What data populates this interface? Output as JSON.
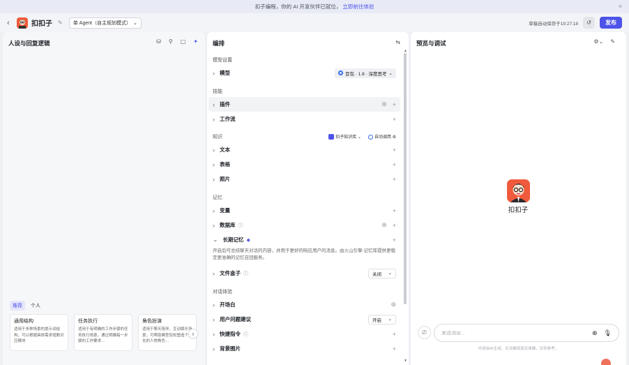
{
  "banner": {
    "text": "扣子编程，你的 AI 开发伙伴已就位，",
    "link": "立即前往体验",
    "close": "×"
  },
  "topbar": {
    "back": "‹",
    "bot_name": "扣扣子",
    "edit": "✎",
    "mode": "单 Agent（自主规划模式）",
    "mode_chevron": "⌄",
    "save_status": "草稿自动保存于19:27:18",
    "history_icon": "↺",
    "publish": "发布"
  },
  "left": {
    "title": "人设与回复逻辑",
    "tools": [
      "⛁",
      "⚲",
      "▢",
      "✦"
    ],
    "tabs": [
      "推荐",
      "个人"
    ],
    "cards": [
      {
        "title": "通用结构",
        "desc": "适用于多种场景的提示词结构，可以根据具体需求增删对应模块"
      },
      {
        "title": "任务执行",
        "desc": "适用于有明确的工作步骤的任务执行场景，通过明确每一步骤的工作要求…"
      },
      {
        "title": "角色扮演",
        "desc": "适用于聊天陪伴、互动娱乐场景，可帮助模型轻松塑造个性化的人物角色…"
      }
    ],
    "next": "›"
  },
  "mid": {
    "title": "编排",
    "icon": "⇆",
    "model_section": "模型设置",
    "model_label": "模型",
    "model_value": "豆包 · 1.8 · 深度思考",
    "skills_section": "技能",
    "plugin": "插件",
    "workflow": "工作流",
    "knowledge_section": "知识",
    "kb_source": "扣子知识库",
    "kb_auto": "自动调用",
    "text": "文本",
    "table": "表格",
    "photo": "照片",
    "memory_section": "记忆",
    "variable": "变量",
    "database": "数据库",
    "longterm": "长期记忆",
    "longterm_desc": "开启后可总结聊天对话的内容，并用于更好的响应用户的消息。由火山引擎-记忆库提供更稳定更准确的记忆召回服务。",
    "filebox": "文件盒子",
    "filebox_value": "关闭",
    "dialog_section": "对话体验",
    "opening": "开场白",
    "suggest": "用户问题建议",
    "suggest_value": "开启",
    "shortcut": "快捷指令",
    "background": "背景图片"
  },
  "right": {
    "title": "预览与调试",
    "tools": [
      "⚙⌄",
      "✎"
    ],
    "bot_name": "扣扣子",
    "input_placeholder": "发送消息...",
    "disclaimer": "内容由AI生成，无法确保真实准确，仅供参考。"
  },
  "colors": {
    "accent": "#4d53e8",
    "avatar": "#f05a3c"
  }
}
